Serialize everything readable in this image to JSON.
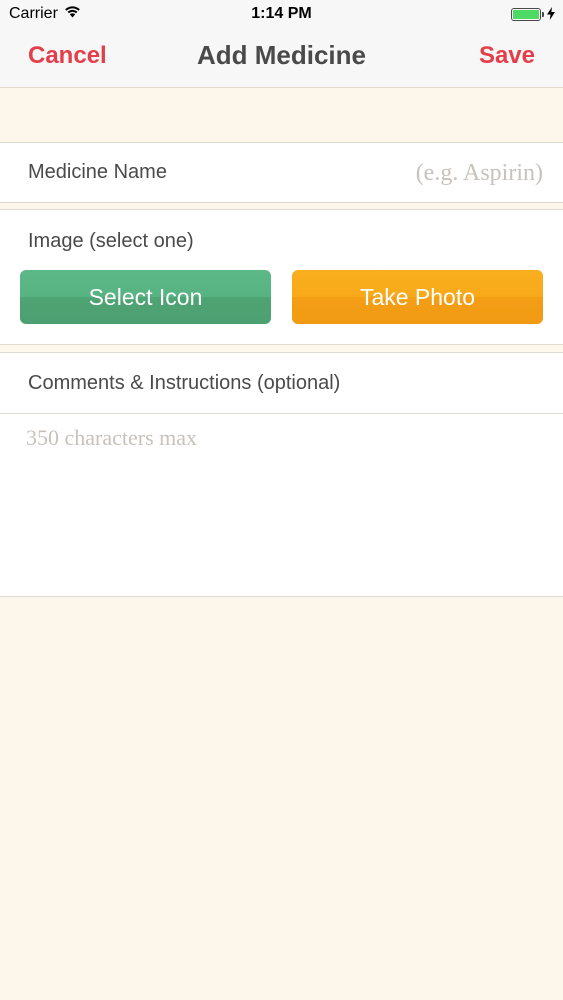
{
  "status_bar": {
    "carrier": "Carrier",
    "time": "1:14 PM",
    "battery_level": 1.0,
    "battery_color": "#4cd964",
    "icons": [
      "wifi-icon",
      "battery-icon",
      "charging-icon"
    ]
  },
  "nav": {
    "cancel_label": "Cancel",
    "title": "Add Medicine",
    "save_label": "Save",
    "accent_color": "#e53e4b"
  },
  "medicine_name": {
    "label": "Medicine Name",
    "placeholder": "(e.g. Aspirin)",
    "value": ""
  },
  "image": {
    "label": "Image (select one)",
    "select_icon_label": "Select Icon",
    "take_photo_label": "Take Photo",
    "select_icon_color": "#57b381",
    "take_photo_color": "#f8a91a"
  },
  "comments": {
    "label": "Comments & Instructions (optional)",
    "placeholder": "350 characters max",
    "value": ""
  },
  "colors": {
    "background": "#fdf6eb",
    "card": "#ffffff",
    "text": "#4a4a4a"
  }
}
